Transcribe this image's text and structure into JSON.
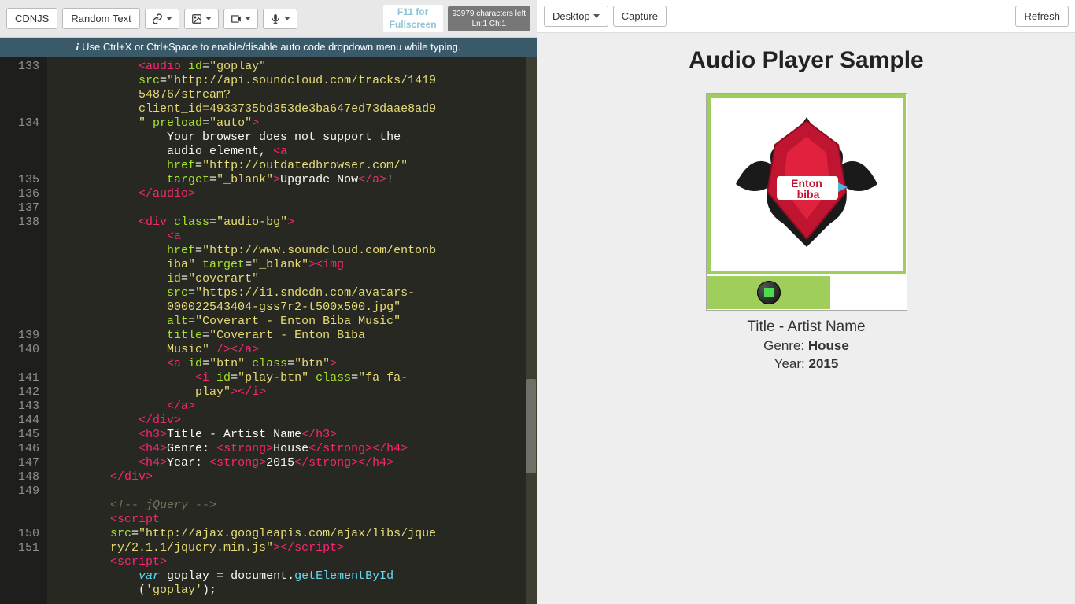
{
  "toolbar": {
    "cdnjs": "CDNJS",
    "random_text": "Random Text",
    "fullscreen_line1": "F11 for",
    "fullscreen_line2": "Fullscreen",
    "charcount_line1": "93979 characters left",
    "charcount_line2": "Ln:1 Ch:1"
  },
  "hint": "Use Ctrl+X or Ctrl+Space to enable/disable auto code dropdown menu while typing.",
  "right_toolbar": {
    "desktop": "Desktop",
    "capture": "Capture",
    "refresh": "Refresh"
  },
  "preview": {
    "heading": "Audio Player Sample",
    "title_artist": "Title - Artist Name",
    "genre_label": "Genre: ",
    "genre_value": "House",
    "year_label": "Year: ",
    "year_value": "2015"
  },
  "gutter_lines": [
    "133",
    "",
    "",
    "",
    "134",
    "",
    "",
    "",
    "135",
    "136",
    "137",
    "138",
    "",
    "",
    "",
    "",
    "",
    "",
    "",
    "139",
    "140",
    "",
    "141",
    "142",
    "143",
    "144",
    "145",
    "146",
    "147",
    "148",
    "149",
    "",
    "",
    "150",
    "151",
    ""
  ],
  "code": {
    "l133": {
      "indent": "            ",
      "tag1": "<audio ",
      "attr1": "id",
      "eq": "=",
      "str1": "\"goplay\""
    },
    "l133b": {
      "indent": "            ",
      "attr": "src",
      "eq": "=",
      "str": "\"http://api.soundcloud.com/tracks/1419"
    },
    "l133c": {
      "indent": "            ",
      "str": "54876/stream?"
    },
    "l133d": {
      "indent": "            ",
      "str": "client_id=4933735bd353de3ba647ed73daae8ad9"
    },
    "l133e": {
      "indent": "            ",
      "str": "\" ",
      "attr": "preload",
      "eq": "=",
      "str2": "\"auto\"",
      "close": ">"
    },
    "l134": {
      "indent": "                ",
      "txt": "Your browser does not support the "
    },
    "l134b": {
      "indent": "                ",
      "txt": "audio element, ",
      "tag": "<a "
    },
    "l134c": {
      "indent": "                ",
      "attr": "href",
      "eq": "=",
      "str": "\"http://outdatedbrowser.com/\" "
    },
    "l134d": {
      "indent": "                ",
      "attr": "target",
      "eq": "=",
      "str": "\"_blank\"",
      "close": ">",
      "txt": "Upgrade Now",
      "tag2": "</a>",
      "txt2": "!"
    },
    "l135": {
      "indent": "            ",
      "tag": "</audio>"
    },
    "l136": "",
    "l137": {
      "indent": "            ",
      "tag": "<div ",
      "attr": "class",
      "eq": "=",
      "str": "\"audio-bg\"",
      "close": ">"
    },
    "l138": {
      "indent": "                ",
      "tag": "<a "
    },
    "l138b": {
      "indent": "                ",
      "attr": "href",
      "eq": "=",
      "str": "\"http://www.soundcloud.com/entonb"
    },
    "l138c": {
      "indent": "                ",
      "str": "iba\" ",
      "attr": "target",
      "eq": "=",
      "str2": "\"_blank\"",
      "close": ">",
      "tag2": "<img "
    },
    "l138d": {
      "indent": "                ",
      "attr": "id",
      "eq": "=",
      "str": "\"coverart\" "
    },
    "l138e": {
      "indent": "                ",
      "attr": "src",
      "eq": "=",
      "str": "\"https://i1.sndcdn.com/avatars-"
    },
    "l138f": {
      "indent": "                ",
      "str": "000022543404-gss7r2-t500x500.jpg\" "
    },
    "l138g": {
      "indent": "                ",
      "attr": "alt",
      "eq": "=",
      "str": "\"Coverart - Enton Biba Music\" "
    },
    "l138h": {
      "indent": "                ",
      "attr": "title",
      "eq": "=",
      "str": "\"Coverart - Enton Biba "
    },
    "l138i": {
      "indent": "                ",
      "str": "Music\" ",
      "close": "/>",
      "tag2": "</a>"
    },
    "l139": {
      "indent": "                ",
      "tag": "<a ",
      "attr": "id",
      "eq": "=",
      "str": "\"btn\" ",
      "attr2": "class",
      "str2": "\"btn\"",
      "close": ">"
    },
    "l140": {
      "indent": "                    ",
      "tag": "<i ",
      "attr": "id",
      "eq": "=",
      "str": "\"play-btn\" ",
      "attr2": "class",
      "str2": "\"fa fa-"
    },
    "l140b": {
      "indent": "                    ",
      "str": "play\"",
      "close": ">",
      "tag2": "</i>"
    },
    "l141": {
      "indent": "                ",
      "tag": "</a>"
    },
    "l142": {
      "indent": "            ",
      "tag": "</div>"
    },
    "l143": {
      "indent": "            ",
      "tag": "<h3>",
      "txt": "Title - Artist Name",
      "tag2": "</h3>"
    },
    "l144": {
      "indent": "            ",
      "tag": "<h4>",
      "txt": "Genre: ",
      "tag2": "<strong>",
      "txt2": "House",
      "tag3": "</strong></h4>"
    },
    "l145": {
      "indent": "            ",
      "tag": "<h4>",
      "txt": "Year: ",
      "tag2": "<strong>",
      "txt2": "2015",
      "tag3": "</strong></h4>"
    },
    "l146": {
      "indent": "        ",
      "tag": "</div>"
    },
    "l147": "",
    "l148": {
      "indent": "        ",
      "cmt": "<!-- jQuery -->"
    },
    "l149": {
      "indent": "        ",
      "tag": "<script "
    },
    "l149b": {
      "indent": "        ",
      "attr": "src",
      "eq": "=",
      "str": "\"http://ajax.googleapis.com/ajax/libs/jque"
    },
    "l149c": {
      "indent": "        ",
      "str": "ry/2.1.1/jquery.min.js\"",
      "close": ">",
      "tag2": "</script>"
    },
    "l150": {
      "indent": "        ",
      "tag": "<script>"
    },
    "l151": {
      "indent": "            ",
      "kw": "var ",
      "nm": "goplay",
      "txt": " = ",
      "obj": "document",
      "dot": ".",
      "fn": "getElementById"
    },
    "l151b": {
      "indent": "            ",
      "p1": "(",
      "str": "'goplay'",
      "p2": ");"
    }
  }
}
